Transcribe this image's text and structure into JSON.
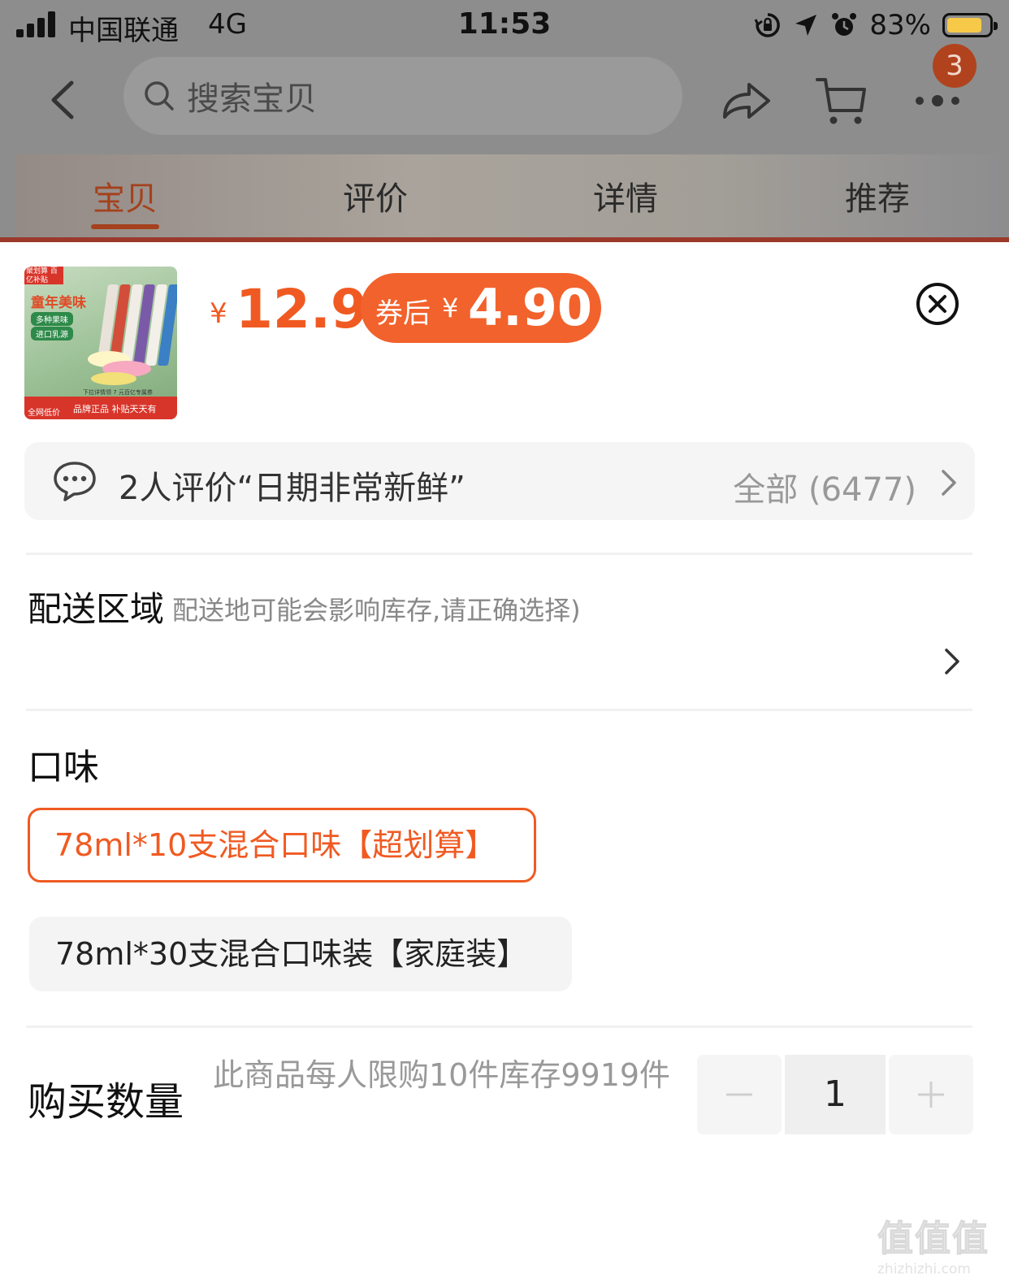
{
  "status_bar": {
    "carrier": "中国联通",
    "network": "4G",
    "time": "11:53",
    "battery_percent": "83%",
    "battery_level": 0.83,
    "icons": [
      "signal-icon",
      "orientation-lock-icon",
      "location-arrow-icon",
      "alarm-icon",
      "battery-icon"
    ]
  },
  "nav": {
    "search_placeholder": "搜索宝贝",
    "cart_badge": "3",
    "icons": [
      "back-icon",
      "search-icon",
      "share-icon",
      "cart-icon",
      "more-icon"
    ]
  },
  "tabs": [
    {
      "label": "宝贝",
      "active": true
    },
    {
      "label": "评价",
      "active": false
    },
    {
      "label": "详情",
      "active": false
    },
    {
      "label": "推荐",
      "active": false
    }
  ],
  "product": {
    "thumbnail": {
      "badge": "聚划算 百亿补贴",
      "title": "童年美味",
      "tags": [
        "多种果味",
        "进口乳源"
      ],
      "small_text": "下拉详情领 7 元百亿专属券",
      "corner": "全网低价",
      "slogan": "品牌正品 补贴天天有"
    },
    "price_currency": "¥",
    "price": "12.9",
    "coupon_label": "券后",
    "coupon_currency": "¥",
    "coupon_price": "4.90"
  },
  "review": {
    "text": "2人评价“日期非常新鲜”",
    "all_label": "全部 (6477)"
  },
  "delivery": {
    "label": "配送区域",
    "hint": "配送地可能会影响库存,请正确选择)"
  },
  "flavor": {
    "label": "口味",
    "options": [
      {
        "label": "78ml*10支混合口味【超划算】",
        "selected": true
      },
      {
        "label": "78ml*30支混合口味装【家庭装】",
        "selected": false
      }
    ]
  },
  "quantity": {
    "label": "购买数量",
    "hint": "此商品每人限购10件库存9919件",
    "value": "1"
  },
  "watermark": {
    "logo": "值值值",
    "site": "zhizhizhi.com"
  },
  "colors": {
    "accent": "#f05a22",
    "coupon_bg": "#f2622c",
    "dim_overlay": "#8d8d8d",
    "option_bg": "#f4f4f4"
  }
}
